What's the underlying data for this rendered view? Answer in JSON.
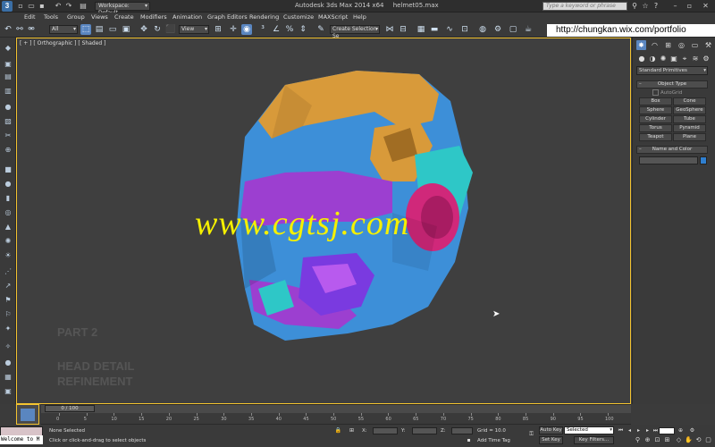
{
  "window": {
    "title": "Autodesk 3ds Max 2014 x64",
    "filename": "helmet05.max",
    "workspace": "Workspace: Default",
    "search_placeholder": "Type a keyword or phrase"
  },
  "menu": [
    "Edit",
    "Tools",
    "Group",
    "Views",
    "Create",
    "Modifiers",
    "Animation",
    "Graph Editors",
    "Rendering",
    "Customize",
    "MAXScript",
    "Help"
  ],
  "toolbar": {
    "selection_filter": "All",
    "reference_coord": "View",
    "named_selection": "Create Selection Se"
  },
  "overlay": {
    "url": "http://chungkan.wix.com/portfolio",
    "watermark": "www.cgtsj.com",
    "part_label": "PART 2",
    "head_detail_line1": "HEAD DETAIL",
    "head_detail_line2": "REFINEMENT"
  },
  "viewport": {
    "label": "[ + ] [ Orthographic ] [ Shaded ]"
  },
  "command_panel": {
    "category": "Standard Primitives",
    "object_type_title": "Object Type",
    "autogrid": "AutoGrid",
    "buttons": [
      "Box",
      "Cone",
      "Sphere",
      "GeoSphere",
      "Cylinder",
      "Tube",
      "Torus",
      "Pyramid",
      "Teapot",
      "Plane"
    ],
    "name_color_title": "Name and Color",
    "color": "#2f7fd0"
  },
  "timeline": {
    "frame_slider": "0 / 100",
    "ticks": [
      "0",
      "5",
      "10",
      "15",
      "20",
      "25",
      "30",
      "35",
      "40",
      "45",
      "50",
      "55",
      "60",
      "65",
      "70",
      "75",
      "80",
      "85",
      "90",
      "95",
      "100"
    ]
  },
  "status": {
    "maxscript": "Welcome to M",
    "none_selected": "None Selected",
    "prompt": "Click or click-and-drag to select objects",
    "grid": "Grid = 10.0",
    "auto_key": "Auto Key",
    "set_key": "Set Key",
    "selected": "Selected",
    "key_filters": "Key Filters...",
    "add_time_tag": "Add Time Tag"
  }
}
